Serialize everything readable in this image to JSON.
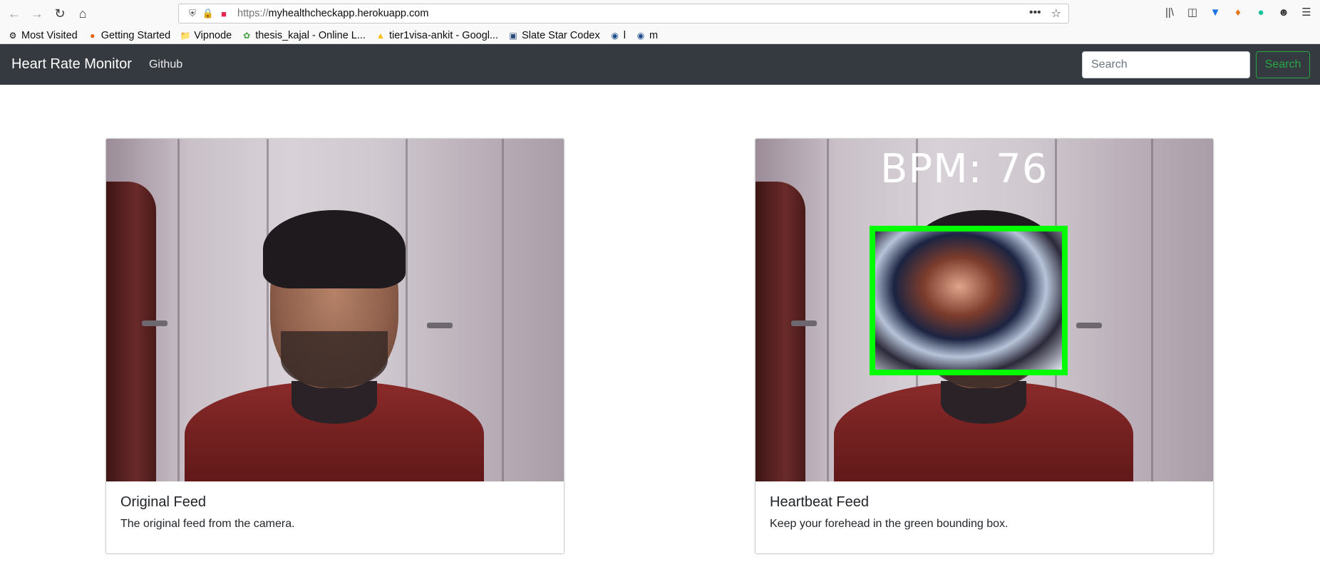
{
  "browser": {
    "url_scheme": "https://",
    "url_host": "myhealthcheckapp.herokuapp.com",
    "url_more": "•••",
    "bookmarks": [
      {
        "label": "Most Visited",
        "icon": "gear-icon"
      },
      {
        "label": "Getting Started",
        "icon": "firefox-icon"
      },
      {
        "label": "Vipnode",
        "icon": "folder-icon"
      },
      {
        "label": "thesis_kajal - Online L...",
        "icon": "overleaf-icon"
      },
      {
        "label": "tier1visa-ankit - Googl...",
        "icon": "google-drive-icon"
      },
      {
        "label": "Slate Star Codex",
        "icon": "page-icon"
      },
      {
        "label": "l",
        "icon": "site-icon"
      },
      {
        "label": "m",
        "icon": "site-icon"
      }
    ]
  },
  "navbar": {
    "brand": "Heart Rate Monitor",
    "link": "Github",
    "search_placeholder": "Search",
    "search_button": "Search"
  },
  "cards": {
    "original": {
      "title": "Original Feed",
      "text": "The original feed from the camera."
    },
    "heartbeat": {
      "title": "Heartbeat Feed",
      "text": "Keep your forehead in the green bounding box.",
      "bpm_overlay": "BPM: 76"
    }
  },
  "colors": {
    "navbar_bg": "#343a40",
    "search_accent": "#28a745",
    "bbox_green": "#00ff00"
  }
}
